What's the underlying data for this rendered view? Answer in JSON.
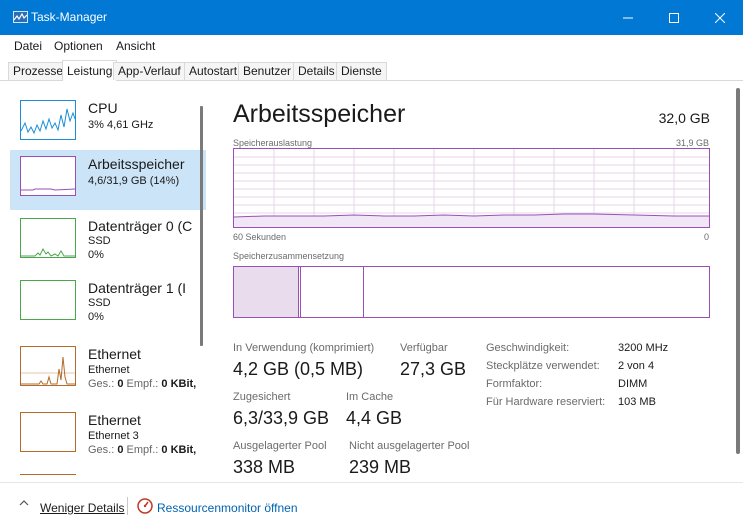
{
  "window": {
    "title": "Task-Manager",
    "accent": "#0078d4",
    "controls": [
      "minimize-icon",
      "maximize-icon",
      "close-icon"
    ]
  },
  "menu": [
    "Datei",
    "Optionen",
    "Ansicht"
  ],
  "tabs": [
    "Prozesse",
    "Leistung",
    "App-Verlauf",
    "Autostart",
    "Benutzer",
    "Details",
    "Dienste"
  ],
  "active_tab": "Leistung",
  "sidebar": {
    "items": [
      {
        "title": "CPU",
        "sub1": "3% 4,61 GHz",
        "graph_color": "#1b8fd8"
      },
      {
        "title": "Arbeitsspeicher",
        "sub1": "4,6/31,9 GB (14%)",
        "graph_color": "#9a4fb5"
      },
      {
        "title": "Datenträger 0 (C",
        "sub1": "SSD",
        "sub2": "0%",
        "graph_color": "#4ca64c"
      },
      {
        "title": "Datenträger 1 (I",
        "sub1": "SSD",
        "sub2": "0%",
        "graph_color": "#4ca64c"
      },
      {
        "title": "Ethernet",
        "sub1": "Ethernet",
        "sub2_label": "Ges.:",
        "sub2_value": "0",
        "sub3_label": "Empf.:",
        "sub3_value": "0 KBit,",
        "graph_color": "#b26b2b"
      },
      {
        "title": "Ethernet",
        "sub1": "Ethernet 3",
        "sub2_label": "Ges.:",
        "sub2_value": "0",
        "sub3_label": "Empf.:",
        "sub3_value": "0 KBit,",
        "graph_color": "#b26b2b"
      }
    ]
  },
  "main": {
    "title": "Arbeitsspeicher",
    "total": "32,0 GB",
    "usage_label": "Speicherauslastung",
    "usage_max": "31,9 GB",
    "time_label": "60 Sekunden",
    "time_zero": "0",
    "composition_label": "Speicherzusammensetzung",
    "graph_color": "#9a4fb5"
  },
  "stats": {
    "in_use_label": "In Verwendung (komprimiert)",
    "in_use_value": "4,2 GB (0,5 MB)",
    "available_label": "Verfügbar",
    "available_value": "27,3 GB",
    "committed_label": "Zugesichert",
    "committed_value": "6,3/33,9 GB",
    "cached_label": "Im Cache",
    "cached_value": "4,4 GB",
    "paged_label": "Ausgelagerter Pool",
    "paged_value": "338 MB",
    "nonpaged_label": "Nicht ausgelagerter Pool",
    "nonpaged_value": "239 MB"
  },
  "details": [
    {
      "label": "Geschwindigkeit:",
      "value": "3200 MHz"
    },
    {
      "label": "Steckplätze verwendet:",
      "value": "2 von 4"
    },
    {
      "label": "Formfaktor:",
      "value": "DIMM"
    },
    {
      "label": "Für Hardware reserviert:",
      "value": "103 MB"
    }
  ],
  "footer": {
    "fewer_details": "Weniger Details",
    "resource_monitor": "Ressourcenmonitor öffnen"
  }
}
